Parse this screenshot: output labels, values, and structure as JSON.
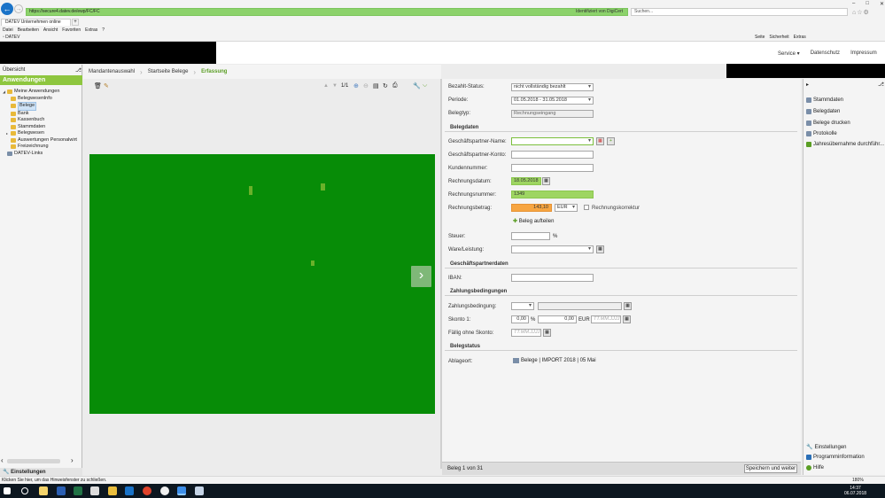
{
  "browser": {
    "url": "https://secure4.datev.de/ewp/FC/FC",
    "cert": "Identifiziert von DigiCert",
    "search_placeholder": "Suchen...",
    "tab_title": "DATEV Unternehmen online",
    "menu": [
      "Datei",
      "Bearbeiten",
      "Ansicht",
      "Favoriten",
      "Extras",
      "?"
    ],
    "favorite": "DATEV",
    "tools": [
      "Seite",
      "Sicherheit",
      "Extras"
    ],
    "status_text": "Klicken Sie hier, um das Hinweisfenster zu schließen.",
    "zoom": "180%"
  },
  "topnav": {
    "service": "Service",
    "datenschutz": "Datenschutz",
    "impressum": "Impressum"
  },
  "sidebar": {
    "overview": "Übersicht",
    "header": "Anwendungen",
    "tree": [
      {
        "label": "Meine Anwendungen",
        "level": 0
      },
      {
        "label": "Belegwesenlnfo",
        "level": 1
      },
      {
        "label": "Belege",
        "level": 1,
        "selected": true
      },
      {
        "label": "Bank",
        "level": 1
      },
      {
        "label": "Kassenbuch",
        "level": 1
      },
      {
        "label": "Stammdaten",
        "level": 1
      },
      {
        "label": "Belegwesen",
        "level": 1
      },
      {
        "label": "Auswertungen Personalwirt",
        "level": 1
      },
      {
        "label": "Freizeichnung",
        "level": 1
      },
      {
        "label": "DATEV-Links",
        "level": 0
      }
    ],
    "settings": "Einstellungen"
  },
  "breadcrumb": [
    "Mandantenauswahl",
    "Startseite Belege",
    "Erfassung"
  ],
  "viewer": {
    "page_indicator": "1/1",
    "accent": "#078c07"
  },
  "form": {
    "bezahlt_status": {
      "label": "Bezahlt-Status:",
      "value": "nicht vollständig bezahlt"
    },
    "periode": {
      "label": "Periode:",
      "value": "01.05.2018 - 31.05.2018"
    },
    "belegtyp": {
      "label": "Belegtyp:",
      "value": "Rechnungseingang"
    },
    "sec_belegdaten": "Belegdaten",
    "gp_name": {
      "label": "Geschäftspartner-Name:",
      "value": ""
    },
    "gp_konto": {
      "label": "Geschäftspartner-Konto:",
      "value": ""
    },
    "kundennummer": {
      "label": "Kundennummer:",
      "value": ""
    },
    "rechnungsdatum": {
      "label": "Rechnungsdatum:",
      "value": "18.05.2018"
    },
    "rechnungsnummer": {
      "label": "Rechnungsnummer:",
      "value": "1349"
    },
    "rechnungsbetrag": {
      "label": "Rechnungsbetrag:",
      "value": "143,10",
      "currency": "EUR"
    },
    "rechnungskorrektur": "Rechnungskorrektur",
    "beleg_aufteilen": "Beleg aufteilen",
    "steuer": {
      "label": "Steuer:",
      "value": "",
      "unit": "%"
    },
    "ware_leistung": {
      "label": "Ware/Leistung:",
      "value": ""
    },
    "sec_gpdaten": "Geschäftspartnerdaten",
    "iban": {
      "label": "IBAN:",
      "value": ""
    },
    "sec_zahlung": "Zahlungsbedingungen",
    "zahlungsbedingung": {
      "label": "Zahlungsbedingung:",
      "value": ""
    },
    "skonto1": {
      "label": "Skonto 1:",
      "percent": "0,00",
      "percent_unit": "%",
      "amount": "0,00",
      "currency": "EUR",
      "date_placeholder": "TT.MM.JJJJ"
    },
    "faellig": {
      "label": "Fällig ohne Skonto:",
      "placeholder": "TT.MM.JJJJ"
    },
    "sec_belegstatus": "Belegstatus",
    "ablageort": {
      "label": "Ablageort:",
      "value": "Belege | IMPORT 2018 | 05 Mai"
    }
  },
  "statusbar": {
    "count": "Beleg 1 von 31",
    "save": "Speichern und weiter"
  },
  "right_panel": {
    "items": [
      "Stammdaten",
      "Belegdaten",
      "Belege drucken",
      "Protokolle",
      "Jahresübernahme durchführ..."
    ],
    "bottom": [
      "Einstellungen",
      "Programminformation",
      "Hilfe"
    ]
  },
  "clock": {
    "time": "14:37",
    "date": "06.07.2018"
  }
}
